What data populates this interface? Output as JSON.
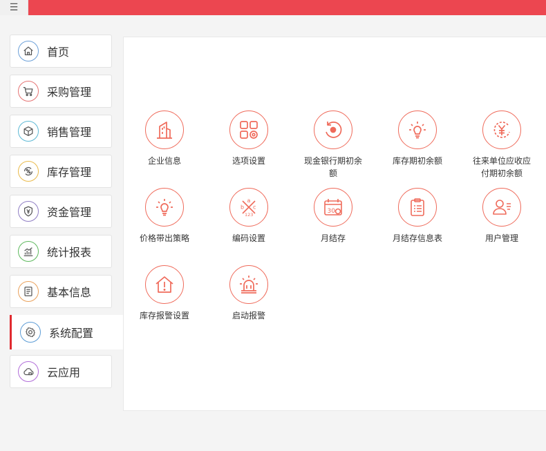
{
  "header": {
    "menu_icon": "hamburger-icon",
    "accent_color": "#ec4650"
  },
  "sidebar": {
    "active_color": "#e02a2f",
    "items": [
      {
        "label": "首页",
        "icon": "home-icon",
        "color": "#6a9fd8"
      },
      {
        "label": "采购管理",
        "icon": "cart-icon",
        "color": "#e57373"
      },
      {
        "label": "销售管理",
        "icon": "box-icon",
        "color": "#5bb8d4"
      },
      {
        "label": "库存管理",
        "icon": "percent-icon",
        "color": "#e9b949"
      },
      {
        "label": "资金管理",
        "icon": "yen-shield-icon",
        "color": "#8e7cc3"
      },
      {
        "label": "统计报表",
        "icon": "chart-icon",
        "color": "#5cb85c"
      },
      {
        "label": "基本信息",
        "icon": "document-icon",
        "color": "#e9a05a"
      },
      {
        "label": "系统配置",
        "icon": "gear-icon",
        "color": "#5b9bd5",
        "active": true
      },
      {
        "label": "云应用",
        "icon": "cloud-icon",
        "color": "#b06bd8"
      }
    ]
  },
  "main": {
    "tile_color": "#ef6a5a",
    "tiles": [
      {
        "label": "企业信息",
        "icon": "building-icon"
      },
      {
        "label": "选项设置",
        "icon": "grid-gear-icon"
      },
      {
        "label": "现金银行期初余额",
        "icon": "refresh-icon"
      },
      {
        "label": "库存期初余额",
        "icon": "bulb-icon"
      },
      {
        "label": "往来单位应收应付期初余额",
        "icon": "yen-circle-icon"
      },
      {
        "label": "价格带出策略",
        "icon": "bulb-icon"
      },
      {
        "label": "编码设置",
        "icon": "abc-icon"
      },
      {
        "label": "月结存",
        "icon": "calendar-icon"
      },
      {
        "label": "月结存信息表",
        "icon": "clipboard-icon"
      },
      {
        "label": "用户管理",
        "icon": "user-icon"
      },
      {
        "label": "库存报警设置",
        "icon": "house-alert-icon"
      },
      {
        "label": "启动报警",
        "icon": "siren-icon"
      }
    ]
  }
}
